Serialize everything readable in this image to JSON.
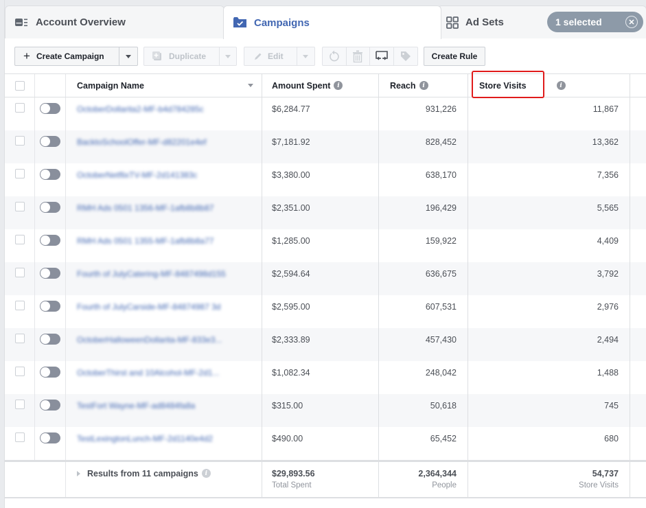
{
  "tabs": {
    "account_overview": "Account Overview",
    "campaigns": "Campaigns",
    "ad_sets": "Ad Sets",
    "selected_pill": "1 selected"
  },
  "toolbar": {
    "create_campaign": "Create Campaign",
    "duplicate": "Duplicate",
    "edit": "Edit",
    "create_rule": "Create Rule"
  },
  "table": {
    "columns": {
      "campaign_name": "Campaign Name",
      "amount_spent": "Amount Spent",
      "reach": "Reach",
      "store_visits": "Store Visits"
    },
    "rows": [
      {
        "name": "OctoberDollarita2-MF-b4d784285c",
        "amount_spent": "$6,284.77",
        "reach": "931,226",
        "store_visits": "11,867"
      },
      {
        "name": "BacktoSchoolOffer-MF-d82201e4ef",
        "amount_spent": "$7,181.92",
        "reach": "828,452",
        "store_visits": "13,362"
      },
      {
        "name": "OctoberNetflixTV-MF-2d141383c",
        "amount_spent": "$3,380.00",
        "reach": "638,170",
        "store_visits": "7,356"
      },
      {
        "name": "RMH Ads 0501 1356-MF-1afb8b8b87",
        "amount_spent": "$2,351.00",
        "reach": "196,429",
        "store_visits": "5,565"
      },
      {
        "name": "RMH Ads 0501 1355-MF-1afb8b8a77",
        "amount_spent": "$1,285.00",
        "reach": "159,922",
        "store_visits": "4,409"
      },
      {
        "name": "Fourth of JulyCatering-MF-8487498d155",
        "amount_spent": "$2,594.64",
        "reach": "636,675",
        "store_visits": "3,792"
      },
      {
        "name": "Fourth of JulyCarside-MF-84874987 3d",
        "amount_spent": "$2,595.00",
        "reach": "607,531",
        "store_visits": "2,976"
      },
      {
        "name": "OctoberHalloweenDollarita-MF-833e3...",
        "amount_spent": "$2,333.89",
        "reach": "457,430",
        "store_visits": "2,494"
      },
      {
        "name": "OctoberThirst and 10Alcohol-MF-2d1...",
        "amount_spent": "$1,082.34",
        "reach": "248,042",
        "store_visits": "1,488"
      },
      {
        "name": "TestFort Wayne-MF-ad8484fa8a",
        "amount_spent": "$315.00",
        "reach": "50,618",
        "store_visits": "745"
      },
      {
        "name": "TestLexingtonLunch-MF-2d1140e4d2",
        "amount_spent": "$490.00",
        "reach": "65,452",
        "store_visits": "680"
      }
    ],
    "footer": {
      "label": "Results from 11 campaigns",
      "amount_spent": "$29,893.56",
      "amount_spent_label": "Total Spent",
      "reach": "2,364,344",
      "reach_label": "People",
      "store_visits": "54,737",
      "store_visits_label": "Store Visits"
    }
  },
  "colors": {
    "accent": "#4267b2",
    "highlight_box": "#e01b1b",
    "selected_pill": "#8d9aa8"
  }
}
